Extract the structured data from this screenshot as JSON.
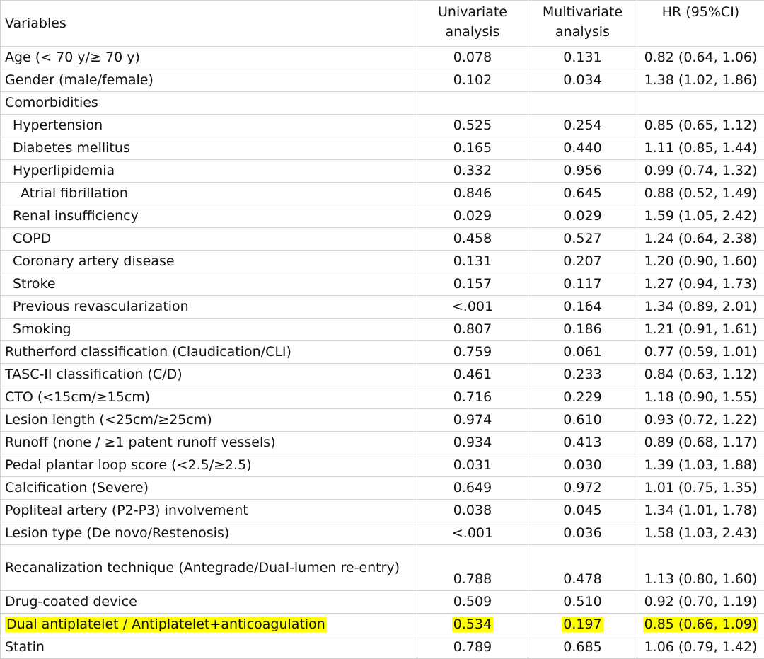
{
  "header": {
    "variables": "Variables",
    "univariate_line1": "Univariate",
    "univariate_line2": "analysis",
    "multivariate_line1": "Multivariate",
    "multivariate_line2": "analysis",
    "hr": "HR (95%CI)"
  },
  "rows": [
    {
      "label": "Age (< 70 y/≥ 70 y)",
      "uni": "0.078",
      "multi": "0.131",
      "hr": "0.82 (0.64, 1.06)"
    },
    {
      "label": "Gender (male/female)",
      "uni": "0.102",
      "multi": "0.034",
      "hr": "1.38 (1.02, 1.86)"
    },
    {
      "label": "Comorbidities",
      "uni": "",
      "multi": "",
      "hr": ""
    },
    {
      "label": "Hypertension",
      "uni": "0.525",
      "multi": "0.254",
      "hr": "0.85 (0.65, 1.12)"
    },
    {
      "label": "Diabetes mellitus",
      "uni": "0.165",
      "multi": "0.440",
      "hr": "1.11 (0.85, 1.44)"
    },
    {
      "label": "Hyperlipidemia",
      "uni": "0.332",
      "multi": "0.956",
      "hr": "0.99 (0.74, 1.32)"
    },
    {
      "label": "Atrial fibrillation",
      "uni": "0.846",
      "multi": "0.645",
      "hr": "0.88 (0.52, 1.49)"
    },
    {
      "label": "Renal insufficiency",
      "uni": "0.029",
      "multi": "0.029",
      "hr": "1.59 (1.05, 2.42)"
    },
    {
      "label": "COPD",
      "uni": "0.458",
      "multi": "0.527",
      "hr": "1.24 (0.64, 2.38)"
    },
    {
      "label": "Coronary artery disease",
      "uni": "0.131",
      "multi": "0.207",
      "hr": "1.20 (0.90, 1.60)"
    },
    {
      "label": "Stroke",
      "uni": "0.157",
      "multi": "0.117",
      "hr": "1.27 (0.94, 1.73)"
    },
    {
      "label": "Previous revascularization",
      "uni": "<.001",
      "multi": "0.164",
      "hr": "1.34 (0.89, 2.01)"
    },
    {
      "label": "Smoking",
      "uni": "0.807",
      "multi": "0.186",
      "hr": "1.21 (0.91, 1.61)"
    },
    {
      "label": "Rutherford classification (Claudication/CLI)",
      "uni": "0.759",
      "multi": "0.061",
      "hr": "0.77 (0.59, 1.01)"
    },
    {
      "label": "TASC-II classification (C/D)",
      "uni": "0.461",
      "multi": "0.233",
      "hr": "0.84 (0.63, 1.12)"
    },
    {
      "label": "CTO (<15cm/≥15cm)",
      "uni": "0.716",
      "multi": "0.229",
      "hr": "1.18 (0.90, 1.55)"
    },
    {
      "label": "Lesion length (<25cm/≥25cm)",
      "uni": "0.974",
      "multi": "0.610",
      "hr": "0.93 (0.72, 1.22)"
    },
    {
      "label": "Runoff (none / ≥1 patent runoff vessels)",
      "uni": "0.934",
      "multi": "0.413",
      "hr": "0.89 (0.68, 1.17)"
    },
    {
      "label": "Pedal plantar loop score (<2.5/≥2.5)",
      "uni": "0.031",
      "multi": "0.030",
      "hr": "1.39 (1.03, 1.88)"
    },
    {
      "label": "Calcification (Severe)",
      "uni": "0.649",
      "multi": "0.972",
      "hr": "1.01 (0.75, 1.35)"
    },
    {
      "label": "Popliteal artery (P2-P3) involvement",
      "uni": "0.038",
      "multi": "0.045",
      "hr": "1.34 (1.01, 1.78)"
    },
    {
      "label": "Lesion type (De novo/Restenosis)",
      "uni": "<.001",
      "multi": "0.036",
      "hr": "1.58 (1.03, 2.43)"
    },
    {
      "label": "Recanalization technique (Antegrade/Dual-lumen re-entry)",
      "uni": "0.788",
      "multi": "0.478",
      "hr": "1.13 (0.80, 1.60)"
    },
    {
      "label": "Drug-coated device",
      "uni": "0.509",
      "multi": "0.510",
      "hr": "0.92 (0.70, 1.19)"
    },
    {
      "label": "Dual antiplatelet / Antiplatelet+anticoagulation",
      "uni": "0.534",
      "multi": "0.197",
      "hr": "0.85 (0.66, 1.09)"
    },
    {
      "label": "Statin",
      "uni": "0.789",
      "multi": "0.685",
      "hr": "1.06 (0.79, 1.42)"
    }
  ],
  "highlight_color": "#ffff00"
}
